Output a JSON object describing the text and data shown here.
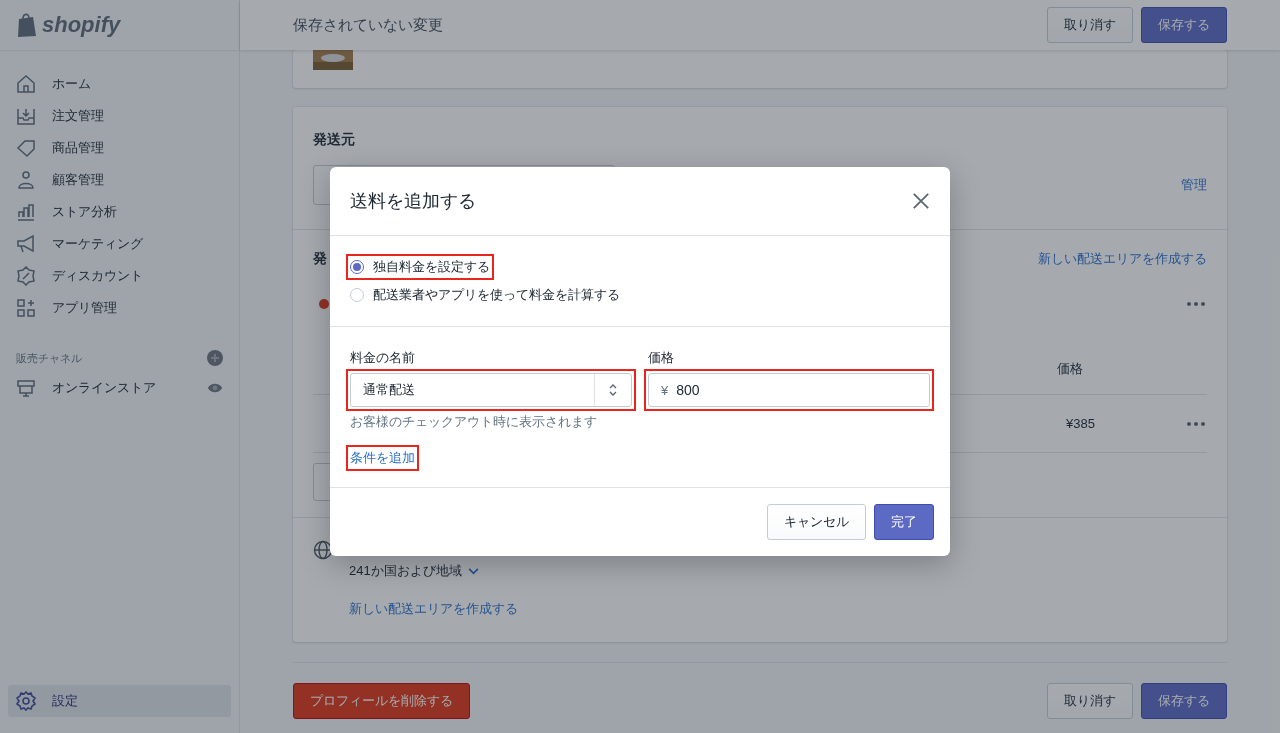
{
  "sidebar": {
    "logo": "shopify",
    "items": [
      {
        "label": "ホーム",
        "selected": false
      },
      {
        "label": "注文管理",
        "selected": false
      },
      {
        "label": "商品管理",
        "selected": false
      },
      {
        "label": "顧客管理",
        "selected": false
      },
      {
        "label": "ストア分析",
        "selected": false
      },
      {
        "label": "マーケティング",
        "selected": false
      },
      {
        "label": "ディスカウント",
        "selected": false
      },
      {
        "label": "アプリ管理",
        "selected": false
      }
    ],
    "channels_heading": "販売チャネル",
    "channels": [
      {
        "label": "オンラインストア",
        "selected": false
      }
    ],
    "settings": {
      "label": "設定",
      "selected": true
    }
  },
  "topbar": {
    "title": "保存されていない変更",
    "buttons": [
      {
        "label": "取り消す",
        "kind": "secondary"
      },
      {
        "label": "保存する",
        "kind": "primary"
      }
    ]
  },
  "card": {
    "heading": "発送元",
    "manage_link": "管理",
    "section_heading": "発",
    "create_link": "新しい配送エリアを作成する",
    "column": "価格",
    "rate_price": "¥385",
    "region": "241か国および地域",
    "region_link": "新しい配送エリアを作成する"
  },
  "footer": {
    "delete": "プロフィールを削除する",
    "buttons": [
      {
        "label": "取り消す",
        "kind": "secondary"
      },
      {
        "label": "保存する",
        "kind": "primary"
      }
    ]
  },
  "modal": {
    "title": "送料を追加する",
    "options": [
      {
        "label": "独自料金を設定する",
        "selected": true,
        "highlighted": true
      },
      {
        "label": "配送業者やアプリを使って料金を計算する",
        "selected": false,
        "highlighted": false
      }
    ],
    "name_field": {
      "label": "料金の名前",
      "value": "通常配送",
      "hint": "お客様のチェックアウト時に表示されます",
      "highlighted": true
    },
    "price_field": {
      "label": "価格",
      "prefix": "¥",
      "value": "800",
      "highlighted": true
    },
    "add_condition": {
      "label": "条件を追加",
      "highlighted": true
    },
    "buttons": [
      {
        "label": "キャンセル",
        "kind": "secondary"
      },
      {
        "label": "完了",
        "kind": "primary"
      }
    ]
  }
}
